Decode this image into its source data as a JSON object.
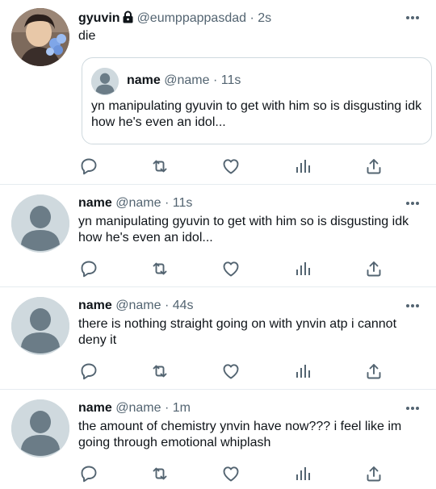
{
  "tweets": [
    {
      "name": "gyuvin",
      "handle": "@eumppappasdad",
      "separator": "·",
      "time": "2s",
      "text": "die",
      "quote": {
        "name": "name",
        "handle": "@name",
        "separator": "·",
        "time": "11s",
        "text": "yn manipulating gyuvin to get with him so is disgusting idk how he's even an idol..."
      }
    },
    {
      "name": "name",
      "handle": "@name",
      "separator": "·",
      "time": "11s",
      "text": "yn manipulating gyuvin to get with him so is disgusting idk how he's even an idol..."
    },
    {
      "name": "name",
      "handle": "@name",
      "separator": "·",
      "time": "44s",
      "text": "there is nothing straight going on with ynvin atp i cannot deny it"
    },
    {
      "name": "name",
      "handle": "@name",
      "separator": "·",
      "time": "1m",
      "text": "the amount of chemistry ynvin have now??? i feel like im going through emotional whiplash"
    }
  ],
  "icons": {
    "reply": "reply-icon",
    "retweet": "retweet-icon",
    "like": "heart-icon",
    "analytics": "analytics-icon",
    "share": "share-icon",
    "more": "more-icon",
    "lock": "lock-icon"
  },
  "colors": {
    "text": "#0f1419",
    "secondary": "#536471",
    "icon": "#536471",
    "divider": "#e6ecf0",
    "avatar_placeholder": "#cfd9de",
    "avatar_silhouette": "#6b7c87"
  }
}
